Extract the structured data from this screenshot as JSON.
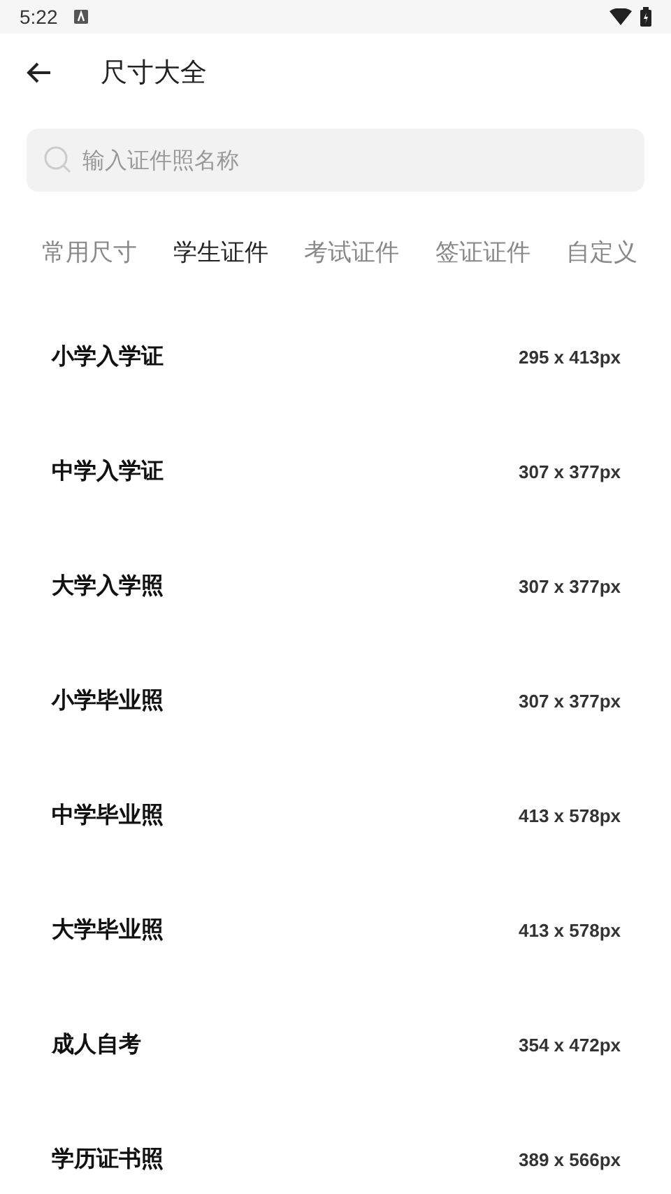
{
  "status_bar": {
    "time": "5:22"
  },
  "header": {
    "title": "尺寸大全"
  },
  "search": {
    "placeholder": "输入证件照名称"
  },
  "tabs": [
    {
      "label": "常用尺寸",
      "selected": false
    },
    {
      "label": "学生证件",
      "selected": true
    },
    {
      "label": "考试证件",
      "selected": false
    },
    {
      "label": "签证证件",
      "selected": false
    },
    {
      "label": "自定义",
      "selected": false
    }
  ],
  "sizes": [
    {
      "name": "小学入学证",
      "size": "295 x 413px"
    },
    {
      "name": "中学入学证",
      "size": "307 x 377px"
    },
    {
      "name": "大学入学照",
      "size": "307 x 377px"
    },
    {
      "name": "小学毕业照",
      "size": "307 x 377px"
    },
    {
      "name": "中学毕业照",
      "size": "413 x 578px"
    },
    {
      "name": "大学毕业照",
      "size": "413 x 578px"
    },
    {
      "name": "成人自考",
      "size": "354 x 472px"
    },
    {
      "name": "学历证书照",
      "size": "389 x 566px"
    }
  ]
}
